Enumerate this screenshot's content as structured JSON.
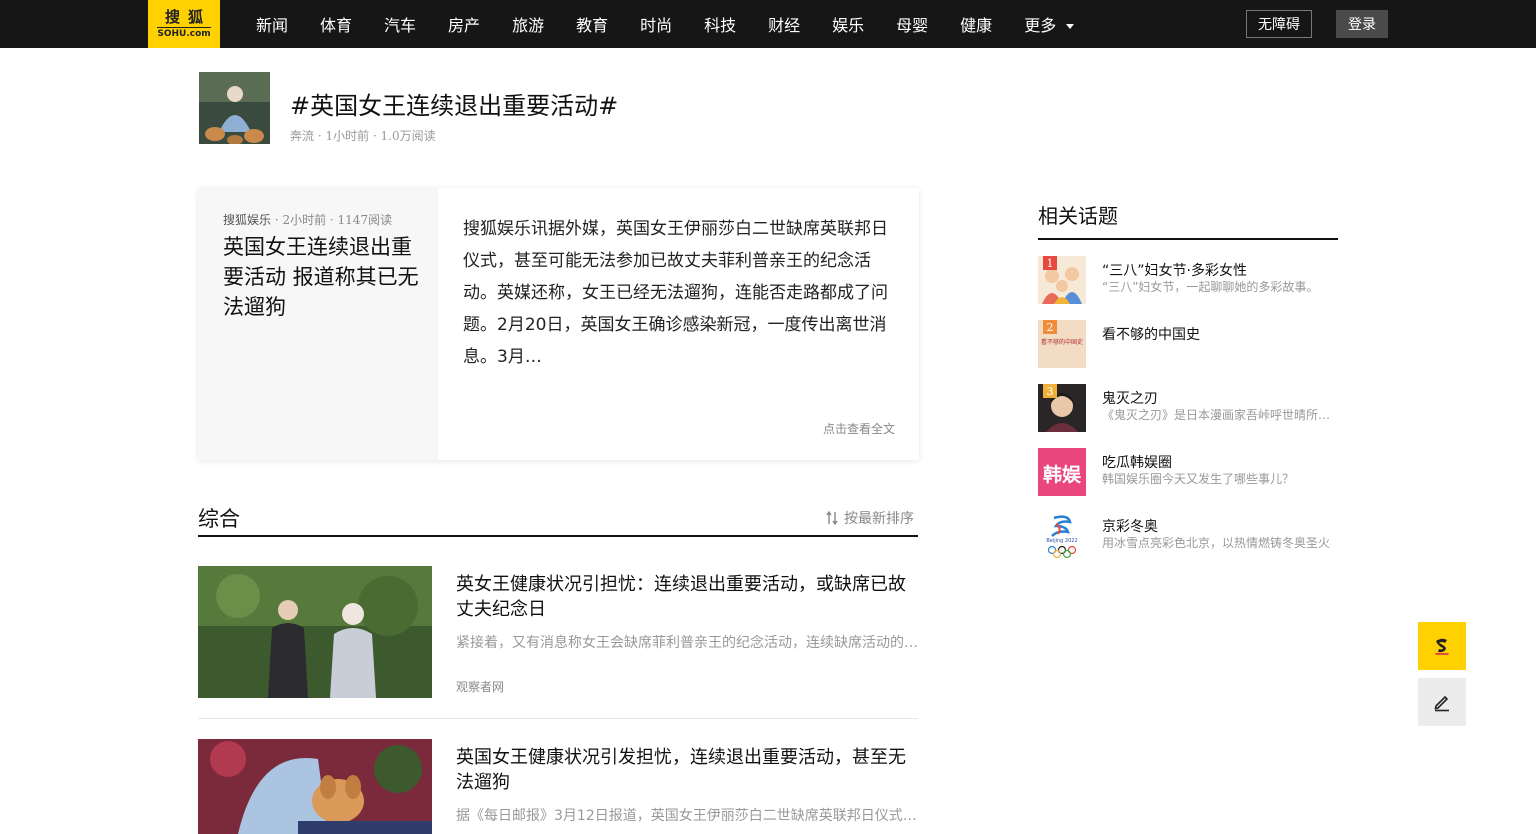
{
  "header": {
    "logo_top": "搜狐",
    "logo_bottom": "SOHU.com",
    "nav": [
      "新闻",
      "体育",
      "汽车",
      "房产",
      "旅游",
      "教育",
      "时尚",
      "科技",
      "财经",
      "娱乐",
      "母婴",
      "健康"
    ],
    "more_label": "更多",
    "accessibility_label": "无障碍",
    "login_label": "登录"
  },
  "topic": {
    "title": "#英国女王连续退出重要活动#",
    "meta": "奔流 · 1小时前 · 1.0万阅读"
  },
  "featured": {
    "source": "搜狐娱乐",
    "meta": " · 2小时前 · 1147阅读",
    "title": "英国女王连续退出重要活动 报道称其已无法遛狗",
    "body": "搜狐娱乐讯据外媒，英国女王伊丽莎白二世缺席英联邦日仪式，甚至可能无法参加已故丈夫菲利普亲王的纪念活动。英媒还称，女王已经无法遛狗，连能否走路都成了问题。2月20日，英国女王确诊感染新冠，一度传出离世消息。3月…",
    "more_label": "点击查看全文"
  },
  "section": {
    "title": "综合",
    "sort_label": "按最新排序"
  },
  "articles": [
    {
      "title": "英女王健康状况引担忧：连续退出重要活动，或缺席已故丈夫纪念日",
      "summary": "紧接着，又有消息称女王会缺席菲利普亲王的纪念活动，连续缺席活动的…",
      "source": "观察者网"
    },
    {
      "title": "英国女王健康状况引发担忧，连续退出重要活动，甚至无法遛狗",
      "summary": "据《每日邮报》3月12日报道，英国女王伊丽莎白二世缺席英联邦日仪式…",
      "source": ""
    }
  ],
  "related": {
    "title": "相关话题",
    "items": [
      {
        "rank": "1",
        "name": "“三八”妇女节·多彩女性",
        "desc": "“三八”妇女节，一起聊聊她的多彩故事。",
        "thumb_text": ""
      },
      {
        "rank": "2",
        "name": "看不够的中国史",
        "desc": "",
        "thumb_text": "看不够的中国史"
      },
      {
        "rank": "3",
        "name": "鬼灭之刃",
        "desc": "《鬼灭之刃》是日本漫画家吾峠呼世晴所著的少年漫画",
        "thumb_text": ""
      },
      {
        "rank": "",
        "name": "吃瓜韩娱圈",
        "desc": "韩国娱乐圈今天又发生了哪些事儿？",
        "thumb_text": "韩娱"
      },
      {
        "rank": "",
        "name": "京彩冬奥",
        "desc": "用冰雪点亮彩色北京，以热情燃铸冬奥圣火",
        "thumb_text": "Beijing 2022"
      }
    ]
  },
  "colors": {
    "accent": "#ffd100",
    "topbar": "#161616",
    "rank1": "#e8483f",
    "rank2": "#f08d3a",
    "rank3": "#f0b13a"
  }
}
